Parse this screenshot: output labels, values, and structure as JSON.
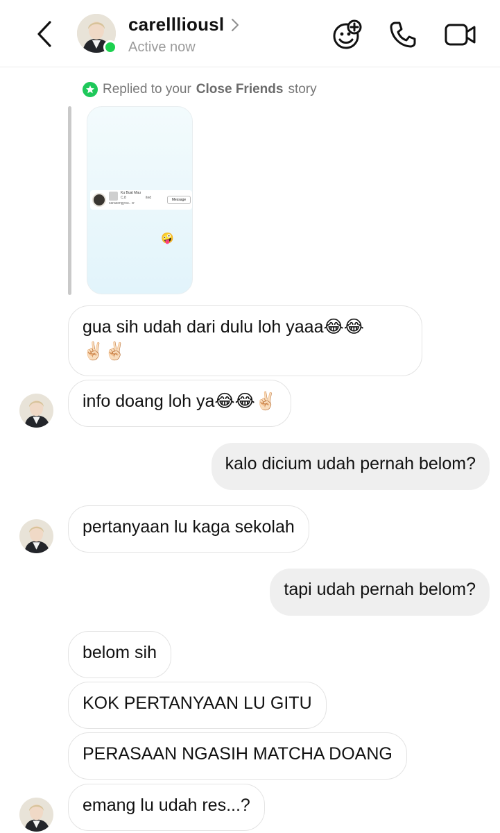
{
  "header": {
    "username": "carellliousl",
    "status": "Active now"
  },
  "story_reply": {
    "prefix": "Replied to your",
    "audience": "Close Friends",
    "suffix": "story",
    "preview": {
      "line1": "Ku Buat Mau",
      "line2": "C.8",
      "line3": "ited",
      "line4": "sarasengyou.. cr",
      "message_button": "Message",
      "sticker": "🤪"
    }
  },
  "messages": [
    {
      "side": "in",
      "text": "gua sih udah dari dulu loh yaaa😂😂",
      "text2": "✌🏻✌🏻"
    },
    {
      "side": "in",
      "text": "info doang loh ya😂😂✌🏻"
    },
    {
      "side": "out",
      "text": "kalo dicium udah pernah belom?"
    },
    {
      "side": "in",
      "text": "pertanyaan lu kaga sekolah"
    },
    {
      "side": "out",
      "text": "tapi udah pernah belom?"
    },
    {
      "side": "in",
      "text": "belom sih"
    },
    {
      "side": "in",
      "text": "KOK PERTANYAAN LU GITU"
    },
    {
      "side": "in",
      "text": "PERASAAN NGASIH MATCHA DOANG"
    },
    {
      "side": "in",
      "text": "emang lu udah res...?"
    }
  ],
  "icons": {
    "back": "chevron-left-icon",
    "effects": "sticker-plus-icon",
    "call": "phone-icon",
    "video": "video-camera-icon"
  },
  "colors": {
    "online": "#1cd14f",
    "close_friends": "#1ec85a",
    "outgoing_bubble": "#efefef",
    "incoming_border": "#e3e3e3"
  }
}
